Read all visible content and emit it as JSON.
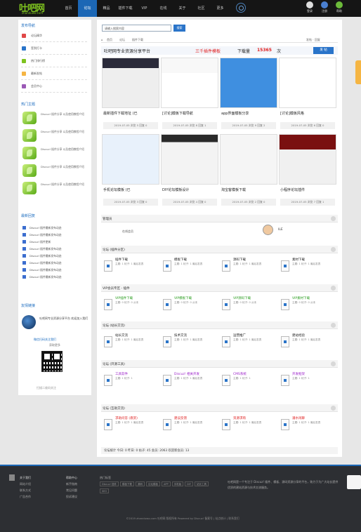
{
  "brand": {
    "name": "吐吧网",
    "domain": "zhanduwo.com"
  },
  "nav": [
    {
      "label": "首页",
      "active": false
    },
    {
      "label": "论坛",
      "active": true
    },
    {
      "label": "精品",
      "active": false
    },
    {
      "label": "插件下载",
      "active": false
    },
    {
      "label": "VIP",
      "active": false
    },
    {
      "label": "在线",
      "active": false
    },
    {
      "label": "关于",
      "active": false
    },
    {
      "label": "社区",
      "active": false
    },
    {
      "label": "更多",
      "active": false
    }
  ],
  "user_links": [
    {
      "label": "登录"
    },
    {
      "label": "注册"
    },
    {
      "label": "帮助"
    }
  ],
  "sidebar": {
    "menu_title": "发布导航",
    "menu": [
      "论坛精华",
      "签到打卡",
      "热门排行榜",
      "最新发帖",
      "会员中心"
    ],
    "hot_title": "热门主题",
    "hot_threads": [
      "Discuz! 插件分享 以及使用教程介绍",
      "Discuz! 插件分享 以及使用教程介绍",
      "Discuz! 插件分享 以及使用教程介绍",
      "Discuz! 插件分享 以及使用教程介绍",
      "Discuz! 插件分享 以及使用教程介绍"
    ],
    "new_title": "最新回复",
    "new_threads": [
      "Discuz! 插件最新发布动态",
      "Discuz! 插件最新发布动态",
      "Discuz! 插件更新",
      "Discuz! 插件最新发布动态",
      "Discuz! 插件最新发布动态",
      "Discuz! 插件最新发布动态",
      "Discuz! 插件最新发布动态",
      "Discuz! 插件最新发布动态"
    ],
    "friend_title": "友情链接",
    "friend_text": "吐吧网专业资源分享平台 欢迎加入我们",
    "qr_title": "微信扫码关注我们",
    "qr_sub": "获取更多",
    "qr_note": "扫描二维码关注"
  },
  "main": {
    "search_placeholder": "请输入搜索内容",
    "search_button": "搜索",
    "crumbs": [
      "首页",
      "论坛",
      "插件下载"
    ],
    "crumbs_right": "发帖 · 回复",
    "banner_left": "吐吧网专业资源分享平台",
    "banner_mid": "三千插件模板",
    "banner_count_label": "下载量",
    "banner_count": "15365",
    "banner_suffix": "次",
    "banner_button": "发 帖",
    "cards": [
      {
        "caption": "最新插件下载地址 (已",
        "meta": "2019-07-05 浏览 5 回复 0"
      },
      {
        "caption": "[讨论]模板下载导航",
        "meta": "2019-07-05 浏览 8 回复 1"
      },
      {
        "caption": "app界面模板分享",
        "meta": "2019-07-05 浏览 9 回复 2"
      },
      {
        "caption": "[讨论]模板风格",
        "meta": "2019-07-05 浏览 6 回复 0"
      },
      {
        "caption": "手机论坛模板 (已",
        "meta": "2019-07-05 浏览 3 回复 0"
      },
      {
        "caption": "DIY论坛模板设计",
        "meta": "2019-07-05 浏览 4 回复 0"
      },
      {
        "caption": "淘宝客模板下载",
        "meta": "2019-07-05 浏览 2 回复 0"
      },
      {
        "caption": "小程序论坛插件",
        "meta": "2019-07-05 浏览 7 回复 1"
      }
    ],
    "forum_admin_title": "管理员",
    "forum_admin_label": "在线会员",
    "forum_admin_user": "ILE",
    "sections": [
      {
        "title": "论坛 (插件分区)",
        "items": [
          {
            "t": "插件下载",
            "m": "主题: 1 帖子: 1 最后发表"
          },
          {
            "t": "模板下载",
            "m": "主题: 1 帖子: 1 最后发表"
          },
          {
            "t": "源码下载",
            "m": "主题: 1 帖子: 1 最后发表"
          },
          {
            "t": "素材下载",
            "m": "主题: 1 帖子: 1 最后发表"
          }
        ]
      },
      {
        "title": "VIP会员专区 - 插件",
        "items": [
          {
            "t": "VIP插件下载",
            "m": "主题: 0 帖子: 0 从未"
          },
          {
            "t": "VIP模板下载",
            "m": "主题: 0 帖子: 0 从未"
          },
          {
            "t": "VIP源码下载",
            "m": "主题: 0 帖子: 0 从未"
          },
          {
            "t": "VIP素材下载",
            "m": "主题: 0 帖子: 0 从未"
          }
        ]
      },
      {
        "title": "论坛 (站长交流)",
        "items": [
          {
            "t": "站长交流",
            "m": "主题: 1 帖子: 1 最后发表"
          },
          {
            "t": "技术交流",
            "m": "主题: 1 帖子: 1 最后发表"
          },
          {
            "t": "运营推广",
            "m": "主题: 1 帖子: 1 最后发表"
          },
          {
            "t": "建站经验",
            "m": "主题: 1 帖子: 1 最后发表"
          }
        ]
      },
      {
        "title": "论坛 (开源工具)",
        "items": [
          {
            "t": "工具软件",
            "m": "主题: 1 帖子: 1"
          },
          {
            "t": "Discuz! 相关开发",
            "m": "主题: 1 帖子: 1 最后发表"
          },
          {
            "t": "CMS系统",
            "m": "主题: 1 帖子: 1"
          },
          {
            "t": "开发框架",
            "m": "主题: 1 帖子: 1"
          }
        ]
      },
      {
        "title": "论坛 (互助交流)",
        "items": [
          {
            "t": "求助问答 (悬赏)",
            "m": "主题: 1 帖子: 1 最后发表"
          },
          {
            "t": "建议反馈",
            "m": "主题: 1 帖子: 1 最后发表"
          },
          {
            "t": "资源求购",
            "m": "主题: 1 帖子: 1 最后发表"
          },
          {
            "t": "灌水闲聊",
            "m": "主题: 1 帖子: 1 最后发表"
          }
        ]
      }
    ],
    "stats": "论坛统计 今日: 0 昨日: 0 帖子: 45 会员: 2063 欢迎新会员: 13"
  },
  "footer": {
    "col1": {
      "title": "关于我们",
      "items": [
        "网站介绍",
        "联系方式",
        "广告合作"
      ]
    },
    "col2": {
      "title": "帮助中心",
      "items": [
        "新手指南",
        "常见问题",
        "投诉建议"
      ]
    },
    "tags_title": "热门标签",
    "tags": [
      "Discuz! 插件",
      "模板下载",
      "源码",
      "论坛模板",
      "APP",
      "手机版",
      "DIY",
      "站长工具",
      "SEO"
    ],
    "about": "吐吧网是一个专注于 Discuz! 插件、模板、源码资源分享的平台，致力于为广大站长提供优质的建站资源与技术交流服务。",
    "copyright": "©2019 zhanduwo.com 吐吧网 版权所有 Powered by Discuz! 备案号 | 站点统计 | 联系我们"
  },
  "colors": {
    "nav_active": "#1c67b5",
    "brand_green": "#7ec31f",
    "accent_red": "#e02020",
    "accent_orange": "#f5b543"
  }
}
